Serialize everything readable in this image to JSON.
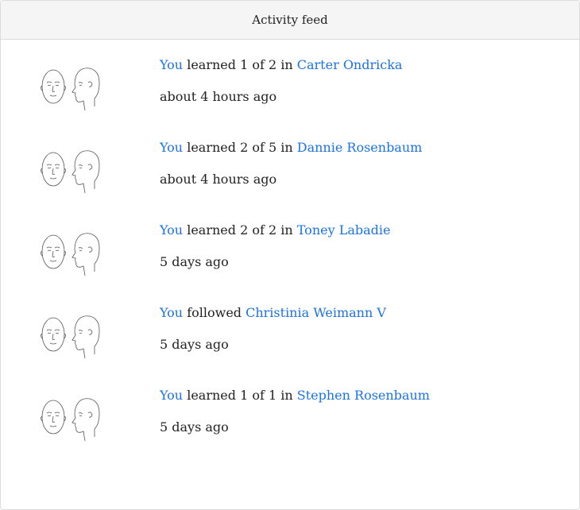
{
  "header": {
    "title": "Activity feed"
  },
  "items": [
    {
      "actor": "You",
      "action": " learned 1 of 2 in ",
      "target": "Carter Ondricka",
      "time": "about 4 hours ago",
      "avatar_icon": "faces-icon"
    },
    {
      "actor": "You",
      "action": " learned 2 of 5 in ",
      "target": "Dannie Rosenbaum",
      "time": "about 4 hours ago",
      "avatar_icon": "faces-icon"
    },
    {
      "actor": "You",
      "action": " learned 2 of 2 in ",
      "target": "Toney Labadie",
      "time": "5 days ago",
      "avatar_icon": "faces-icon"
    },
    {
      "actor": "You",
      "action": " followed ",
      "target": "Christinia Weimann V",
      "time": "5 days ago",
      "avatar_icon": "faces-icon"
    },
    {
      "actor": "You",
      "action": " learned 1 of 1 in ",
      "target": "Stephen Rosenbaum",
      "time": "5 days ago",
      "avatar_icon": "faces-icon"
    }
  ],
  "colors": {
    "link": "#1a73e8",
    "header_bg": "#f5f5f5",
    "border": "#dcdcdc",
    "text": "#222222"
  }
}
